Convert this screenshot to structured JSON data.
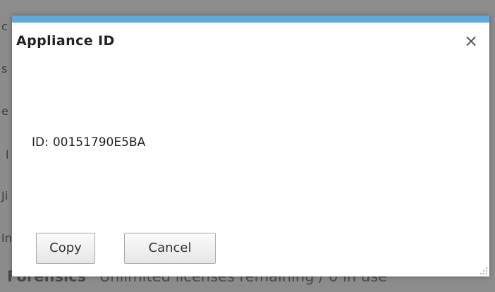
{
  "background": {
    "fragments": [
      "c",
      "s",
      "e",
      "l",
      "Ji",
      "In"
    ],
    "footer_bold": "Forensics",
    "footer_text": "Unlimited licenses remaining / 0 in use"
  },
  "dialog": {
    "title": "Appliance ID",
    "close_symbol": "×",
    "id_label": "ID:",
    "id_value": "00151790E5BA",
    "copy_label": "Copy",
    "cancel_label": "Cancel",
    "accent_color": "#5fa9dc"
  }
}
